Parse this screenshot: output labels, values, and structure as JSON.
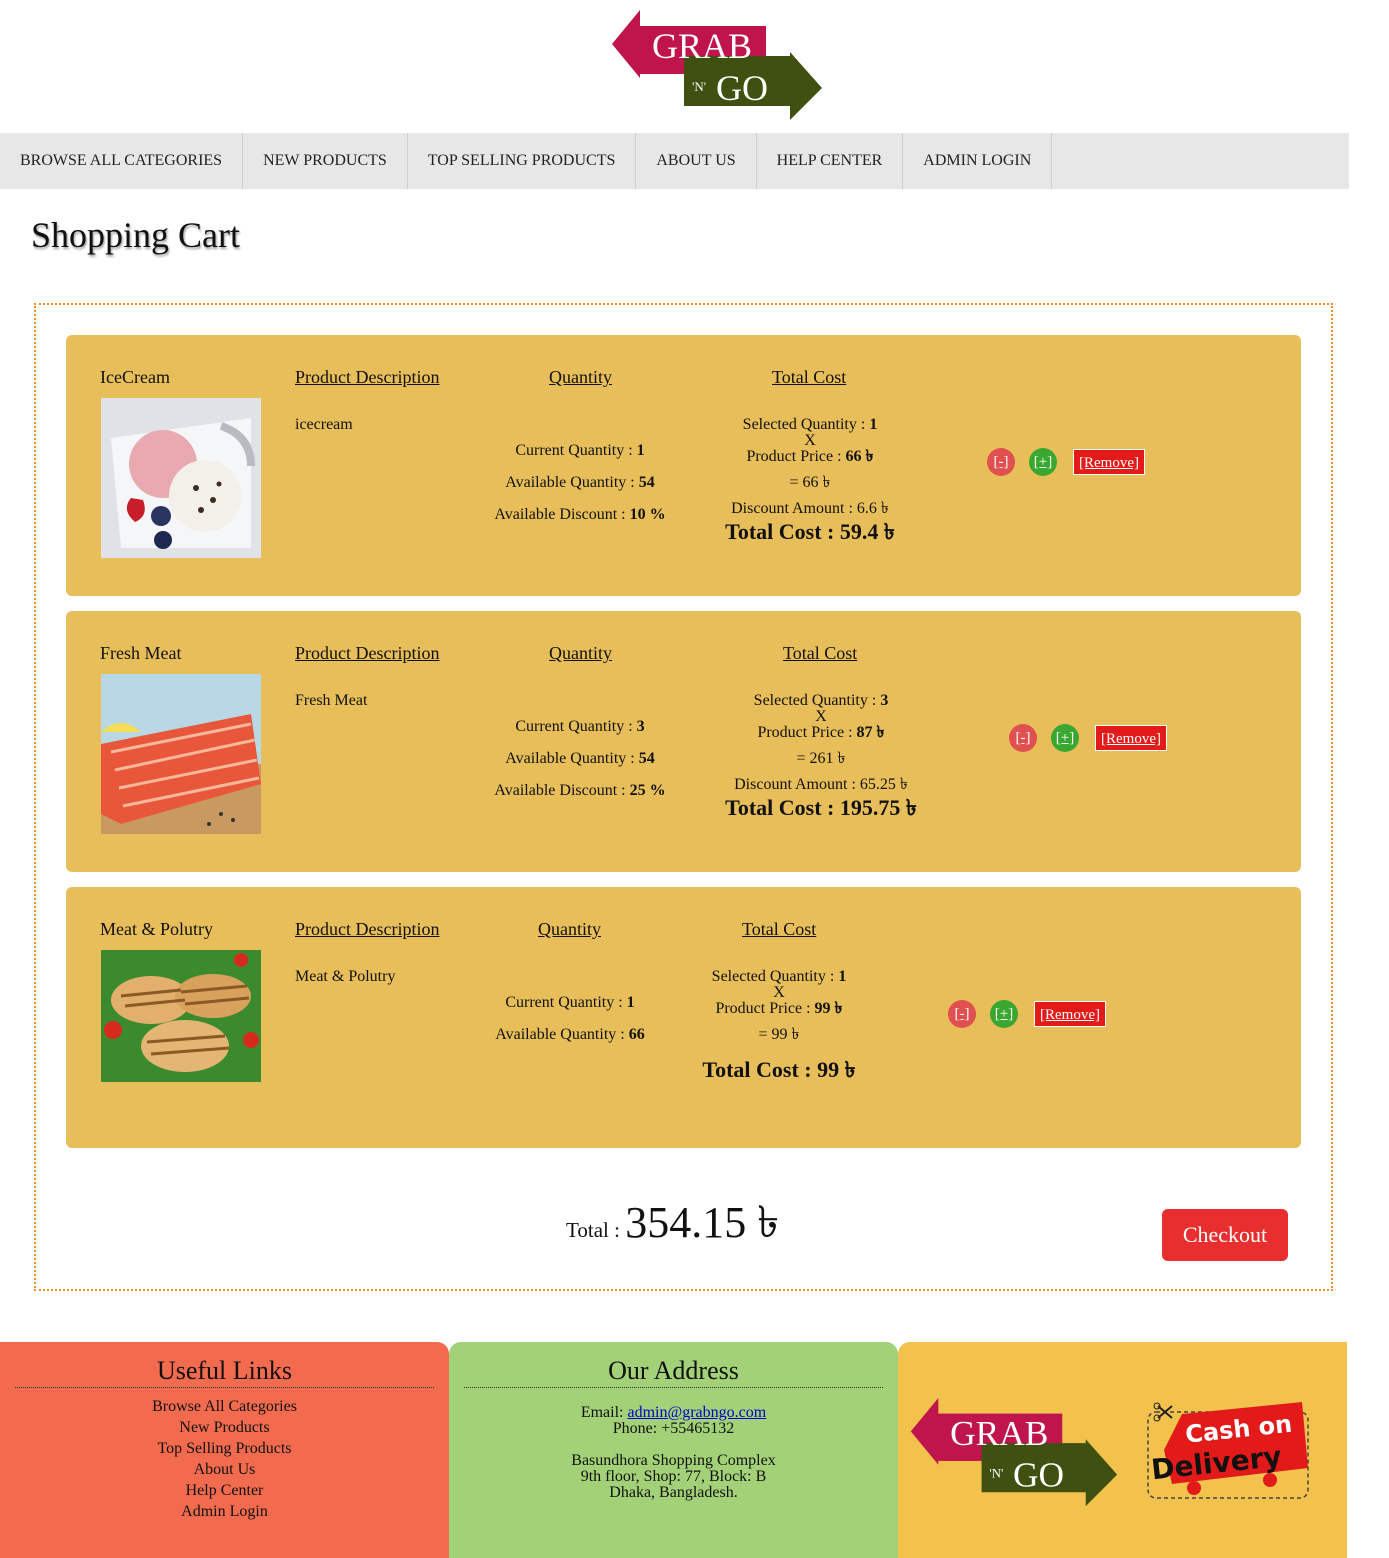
{
  "logo": {
    "top": "GRAB",
    "mid": "'N'",
    "bottom": "GO"
  },
  "nav": [
    "BROWSE ALL CATEGORIES",
    "NEW PRODUCTS",
    "TOP SELLING PRODUCTS",
    "ABOUT US",
    "HELP CENTER",
    "ADMIN LOGIN"
  ],
  "page_title": "Shopping Cart",
  "headers": {
    "description": "Product Description",
    "quantity": "Quantity",
    "total": "Total Cost"
  },
  "items": [
    {
      "name": "IceCream",
      "description": "icecream",
      "current_label": "Current Quantity : ",
      "current": "1",
      "available_label": "Available Quantity : ",
      "available": "54",
      "discount_label": "Available Discount : ",
      "discount": "10 %",
      "selected_label": "Selected Quantity : ",
      "selected": "1",
      "x": "X",
      "price_label": "Product Price : ",
      "price": "66 ৳",
      "subtotal": "= 66 ৳",
      "discount_amount": "Discount Amount : 6.6 ৳",
      "total": "Total Cost : 59.4 ৳"
    },
    {
      "name": "Fresh Meat",
      "description": "Fresh Meat",
      "current_label": "Current Quantity : ",
      "current": "3",
      "available_label": "Available Quantity : ",
      "available": "54",
      "discount_label": "Available Discount : ",
      "discount": "25 %",
      "selected_label": "Selected Quantity : ",
      "selected": "3",
      "x": "X",
      "price_label": "Product Price : ",
      "price": "87 ৳",
      "subtotal": "= 261 ৳",
      "discount_amount": "Discount Amount : 65.25 ৳",
      "total": "Total Cost : 195.75 ৳"
    },
    {
      "name": "Meat & Polutry",
      "description": "Meat & Polutry",
      "current_label": "Current Quantity : ",
      "current": "1",
      "available_label": "Available Quantity : ",
      "available": "66",
      "selected_label": "Selected Quantity : ",
      "selected": "1",
      "x": "X",
      "price_label": "Product Price : ",
      "price": "99 ৳",
      "subtotal": "= 99 ৳",
      "total": "Total Cost : 99 ৳"
    }
  ],
  "buttons": {
    "minus": "[-]",
    "plus": "[+]",
    "remove": "[Remove]",
    "checkout": "Checkout"
  },
  "grand_total": {
    "label": "Total : ",
    "value": "354.15 ৳"
  },
  "footer": {
    "links_title": "Useful Links",
    "links": [
      "Browse All Categories",
      "New Products",
      "Top Selling Products",
      "About Us",
      "Help Center",
      "Admin Login"
    ],
    "address_title": "Our Address",
    "email_label": "Email: ",
    "email": " admin@grabngo.com",
    "phone": "Phone: +55465132",
    "address_lines": [
      "Basundhora Shopping Complex",
      "9th floor, Shop: 77, Block: B",
      "Dhaka, Bangladesh."
    ],
    "cod_line1": "Cash on",
    "cod_line2": "Delivery"
  },
  "colors": {
    "nav_bg": "#e7e7e7",
    "item_bg": "#e8be5a",
    "remove": "#e21a1a",
    "checkout": "#e82e2e",
    "footer1": "#f26b4e",
    "footer2": "#a3d177",
    "footer3": "#f2c24d",
    "logo_red": "#c0144c",
    "logo_green": "#3f5010"
  }
}
